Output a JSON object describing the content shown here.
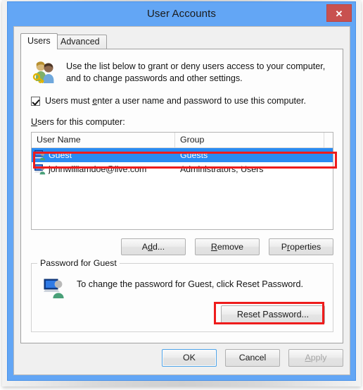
{
  "window": {
    "title": "User Accounts",
    "close_label": "✕",
    "close_icon": "close-icon"
  },
  "tabs": [
    {
      "label": "Users",
      "active": true
    },
    {
      "label": "Advanced",
      "active": false
    }
  ],
  "intro": {
    "icon": "users-with-key-icon",
    "line1": "Use the list below to grant or deny users access to your computer,",
    "line2": "and to change passwords and other settings."
  },
  "checkbox": {
    "checked": true,
    "text_before": "Users must ",
    "accel": "e",
    "text_after": "nter a user name and password to use this computer."
  },
  "list": {
    "label_accel": "U",
    "label_rest": "sers for this computer:",
    "columns": [
      "User Name",
      "Group"
    ],
    "rows": [
      {
        "name": "Guest",
        "group": "Guests",
        "selected": true,
        "icon": "user-account-icon"
      },
      {
        "name": "johnwilliamdoe@live.com",
        "group": "Administrators; Users",
        "selected": false,
        "icon": "user-account-icon"
      }
    ]
  },
  "buttons": {
    "add": {
      "pre": "A",
      "accel": "d",
      "post": "d..."
    },
    "remove": {
      "pre": "",
      "accel": "R",
      "post": "emove"
    },
    "properties": {
      "pre": "P",
      "accel": "r",
      "post": "operties"
    }
  },
  "password_group": {
    "title": "Password for Guest",
    "icon": "user-monitor-icon",
    "description": "To change the password for Guest, click Reset Password.",
    "reset_button": "Reset Password..."
  },
  "footer": {
    "ok": "OK",
    "cancel": "Cancel",
    "apply_pre": "",
    "apply_accel": "A",
    "apply_post": "pply",
    "apply_disabled": true
  },
  "colors": {
    "titlebar": "#63a6f5",
    "close": "#c8514f",
    "selection": "#2a8bf2",
    "annotation": "#ee1c1c"
  }
}
